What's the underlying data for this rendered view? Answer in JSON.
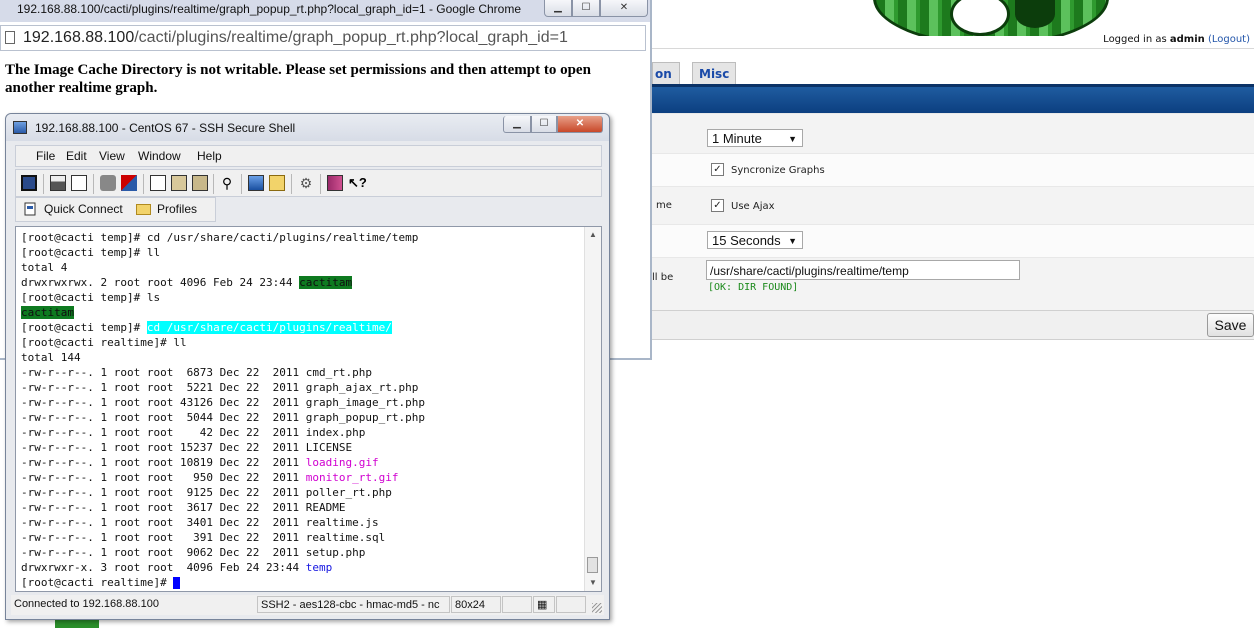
{
  "background_page": {
    "login_prefix": "Logged in as",
    "login_user": "admin",
    "logout_link": "(Logout)",
    "tabs": [
      {
        "label": "on"
      },
      {
        "label": "Misc"
      }
    ],
    "rows": {
      "fragment_time": "me",
      "fragment_path": "ll be",
      "refresh_select": "1 Minute",
      "sync_label": "Syncronize Graphs",
      "ajax_label": "Use Ajax",
      "window_select": "15 Seconds",
      "cache_path_value": "/usr/share/cacti/plugins/realtime/temp",
      "dir_status": "[OK: DIR FOUND]"
    },
    "save_label": "Save"
  },
  "chrome_popup": {
    "window_title": "192.168.88.100/cacti/plugins/realtime/graph_popup_rt.php?local_graph_id=1 - Google Chrome",
    "url_host": "192.168.88.100",
    "url_path": "/cacti/plugins/realtime/graph_popup_rt.php?local_graph_id=1",
    "message": "The Image Cache Directory is not writable. Please set permissions and then attempt to open another realtime graph."
  },
  "ssh_window": {
    "title": "192.168.88.100 - CentOS 67 - SSH Secure Shell",
    "menu": [
      "File",
      "Edit",
      "View",
      "Window",
      "Help"
    ],
    "toolbar_icons": [
      "save-icon",
      "print-icon",
      "print-preview-icon",
      "disconnect-icon",
      "new-connection-icon",
      "copy-icon",
      "paste-icon",
      "paste-special-icon",
      "find-icon",
      "settings-icon",
      "profiles-icon",
      "tools-icon",
      "help-book-icon",
      "whats-this-icon"
    ],
    "quick_connect": "Quick Connect",
    "profiles": "Profiles",
    "terminal": {
      "prompt_temp": "[root@cacti temp]# ",
      "prompt_realtime": "[root@cacti realtime]# ",
      "cmd_cd_temp": "cd /usr/share/cacti/plugins/realtime/temp",
      "cmd_ll": "ll",
      "cmd_ls": "ls",
      "cmd_cd_realtime": "cd /usr/share/cacti/plugins/realtime/",
      "total_4": "total 4",
      "dir_line_prefix": "drwxrwxrwx. 2 root root 4096 Feb 24 23:44 ",
      "dir_name": "cactitam",
      "total_144": "total 144",
      "listing": [
        {
          "prefix": "-rw-r--r--. 1 root root  6873 Dec 22  2011 ",
          "name": "cmd_rt.php"
        },
        {
          "prefix": "-rw-r--r--. 1 root root  5221 Dec 22  2011 ",
          "name": "graph_ajax_rt.php"
        },
        {
          "prefix": "-rw-r--r--. 1 root root 43126 Dec 22  2011 ",
          "name": "graph_image_rt.php"
        },
        {
          "prefix": "-rw-r--r--. 1 root root  5044 Dec 22  2011 ",
          "name": "graph_popup_rt.php"
        },
        {
          "prefix": "-rw-r--r--. 1 root root    42 Dec 22  2011 ",
          "name": "index.php"
        },
        {
          "prefix": "-rw-r--r--. 1 root root 15237 Dec 22  2011 ",
          "name": "LICENSE"
        },
        {
          "prefix": "-rw-r--r--. 1 root root 10819 Dec 22  2011 ",
          "name": "loading.gif"
        },
        {
          "prefix": "-rw-r--r--. 1 root root   950 Dec 22  2011 ",
          "name": "monitor_rt.gif"
        },
        {
          "prefix": "-rw-r--r--. 1 root root  9125 Dec 22  2011 ",
          "name": "poller_rt.php"
        },
        {
          "prefix": "-rw-r--r--. 1 root root  3617 Dec 22  2011 ",
          "name": "README"
        },
        {
          "prefix": "-rw-r--r--. 1 root root  3401 Dec 22  2011 ",
          "name": "realtime.js"
        },
        {
          "prefix": "-rw-r--r--. 1 root root   391 Dec 22  2011 ",
          "name": "realtime.sql"
        },
        {
          "prefix": "-rw-r--r--. 1 root root  9062 Dec 22  2011 ",
          "name": "setup.php"
        },
        {
          "prefix": "drwxrwxr-x. 3 root root  4096 Feb 24 23:44 ",
          "name": "temp"
        }
      ]
    },
    "status": {
      "connection": "Connected to 192.168.88.100",
      "cipher": "SSH2 - aes128-cbc - hmac-md5 - nc",
      "size": "80x24"
    }
  },
  "colors": {
    "terminal_dir_highlight": "#0e7a20",
    "terminal_selection": "#00ffff",
    "terminal_image_files": "#d000d0",
    "terminal_directory": "#1515e0",
    "cacti_bar": "#0c3f80",
    "dir_ok": "#1c8a1c"
  }
}
